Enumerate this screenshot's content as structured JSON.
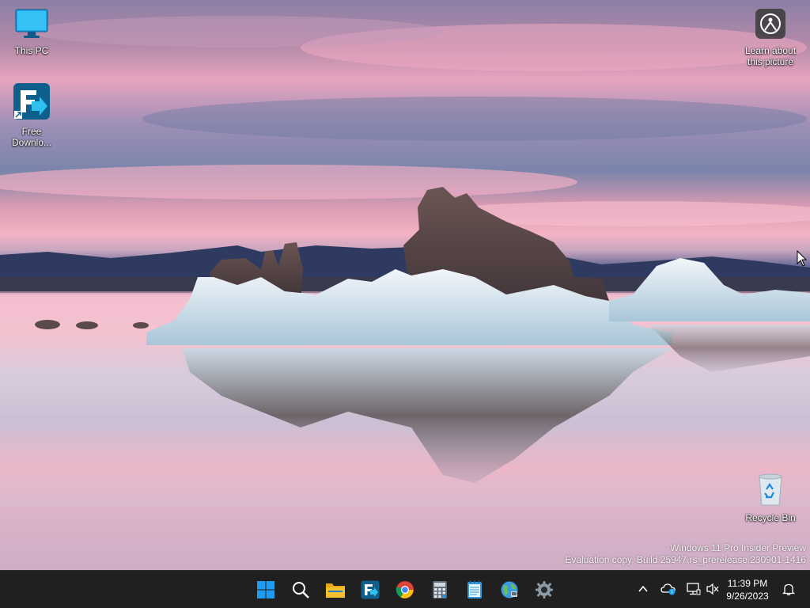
{
  "desktop": {
    "icons": [
      {
        "id": "this-pc",
        "label": "This PC"
      },
      {
        "id": "free-download-manager",
        "label": "Free Downlo..."
      },
      {
        "id": "learn-about-picture",
        "label": "Learn about this picture"
      },
      {
        "id": "recycle-bin",
        "label": "Recycle Bin"
      }
    ]
  },
  "watermark": {
    "line1": "Windows 11 Pro Insider Preview",
    "line2": "Evaluation copy. Build 25947.rs_prerelease.230901-1416"
  },
  "taskbar": {
    "apps": [
      {
        "name": "start-button",
        "icon": "windows-logo-icon"
      },
      {
        "name": "search-button",
        "icon": "search-icon"
      },
      {
        "name": "file-explorer-button",
        "icon": "folder-icon"
      },
      {
        "name": "free-download-manager-button",
        "icon": "fdm-icon"
      },
      {
        "name": "chrome-button",
        "icon": "chrome-icon"
      },
      {
        "name": "calculator-button",
        "icon": "calculator-icon"
      },
      {
        "name": "notepad-button",
        "icon": "notepad-icon"
      },
      {
        "name": "network-globe-button",
        "icon": "globe-icon"
      },
      {
        "name": "settings-button",
        "icon": "gear-icon"
      }
    ],
    "tray": {
      "icons": [
        "chevron-up-icon",
        "onedrive-icon",
        "network-icon",
        "volume-muted-icon",
        "notification-bell-icon"
      ],
      "time": "11:39 PM",
      "date": "9/26/2023"
    }
  },
  "colors": {
    "taskbar_bg": "#202020",
    "windows_blue": "#0a84d8",
    "folder_yellow": "#f5c02e"
  }
}
